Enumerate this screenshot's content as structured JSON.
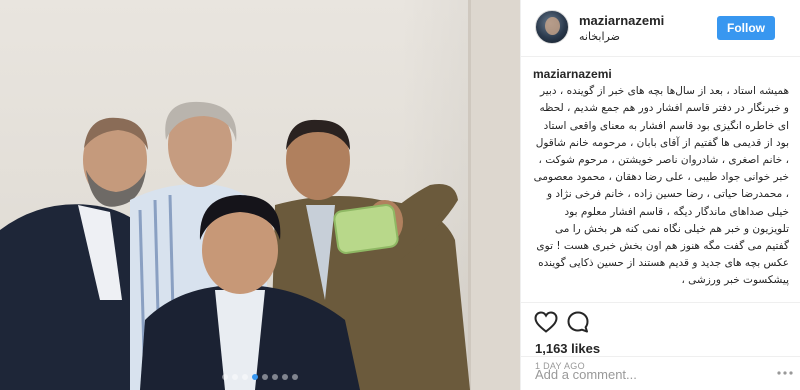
{
  "post": {
    "username": "maziarnazemi",
    "location": "ضرابخانه",
    "follow_label": "Follow",
    "caption": {
      "username": "maziarnazemi",
      "text": "همیشه استاد ، بعد از سال‌ها بچه های خبر از گوینده ، دبیر و خبرنگار در دفتر قاسم افشار دور هم جمع شدیم ، لحظه ای خاطره انگیزی بود قاسم افشار به معنای واقعی استاد بود از قدیمی ها گفتیم از آقای بابان ، مرحومه خانم شاقول ، خانم اصغری ، شادروان ناصر خویشتن ، مرحوم شوکت ، خبر خوانی جواد طیبی ، علی رضا دهقان ، محمود معصومی ، محمدرضا حیاتی ، رضا حسین زاده ، خانم فرخی نژاد و خیلی صداهای ماندگار دیگه ، قاسم افشار معلوم بود تلویزیون و خبر هم خیلی نگاه نمی کنه هر بخش را می گفتیم می گفت مگه هنوز هم اون بخش خبری هست ! توی عکس بچه های جدید و قدیم هستند از حسین ذکایی گوینده پیشکسوت خبر ورزشی ،"
    },
    "likes": "1,163 likes",
    "time_ago": "1 DAY AGO",
    "comment_placeholder": "Add a comment...",
    "carousel": {
      "count": 8,
      "active_index": 3
    },
    "colors": {
      "accent": "#3897f0",
      "text": "#262626",
      "muted": "#999999",
      "border": "#efefef"
    },
    "icons": [
      "heart-icon",
      "comment-icon",
      "more-options-icon"
    ]
  }
}
